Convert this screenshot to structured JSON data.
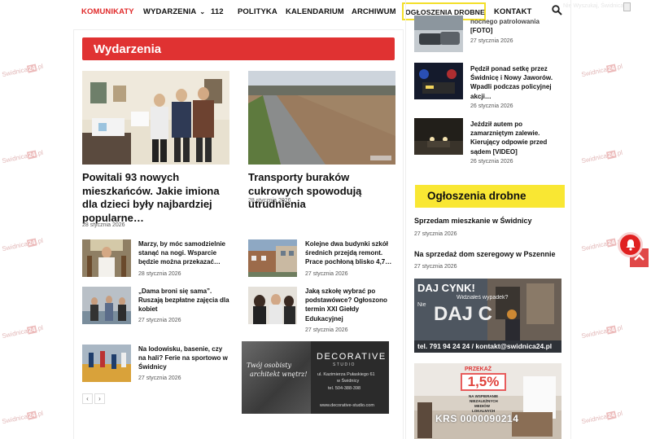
{
  "nav": {
    "items": [
      "KOMUNIKATY",
      "WYDARZENIA",
      "112",
      "POLITYKA",
      "KALENDARIUM",
      "ARCHIWUM",
      "OGŁOSZENIA DROBNE",
      "KONTAKT"
    ],
    "active": "KOMUNIKATY",
    "highlighted": "OGŁOSZENIA DROBNE",
    "ghost_text": "Nie Wyszukaj, Świdnica",
    "icons": [
      "chevron-down-icon",
      "search-icon"
    ]
  },
  "watermark": {
    "prefix": "Swidnica",
    "suffix": "24",
    "tld": ".pl"
  },
  "section": {
    "title": "Wydarzenia"
  },
  "featured": [
    {
      "title": "Powitali 93 nowych mieszkańców. Jakie imiona dla dzieci były najbardziej popularne…",
      "date": "28 stycznia 2026"
    },
    {
      "title": "Transporty buraków cukrowych spowodują utrudnienia",
      "date": "28 stycznia 2026"
    }
  ],
  "small_left": [
    {
      "title": "Marzy, by móc samodzielnie stanąć na nogi. Wsparcie będzie można przekazać…",
      "date": "28 stycznia 2026"
    },
    {
      "title": "„Dama broni się sama”. Ruszają bezpłatne zajęcia dla kobiet",
      "date": "27 stycznia 2026"
    },
    {
      "title": "Na lodowisku, basenie, czy na hali? Ferie na sportowo w Świdnicy",
      "date": "27 stycznia 2026"
    }
  ],
  "small_right": [
    {
      "title": "Kolejne dwa budynki szkół średnich przejdą remont. Prace pochłoną blisko 4,7…",
      "date": "27 stycznia 2026"
    },
    {
      "title": "Jaką szkołę wybrać po podstawówce? Ogłoszono termin XXI Giełdy Edukacyjnej",
      "date": "27 stycznia 2026"
    }
  ],
  "pager": {
    "prev": "‹",
    "next": "›"
  },
  "ad_decorative": {
    "script_line1": "Twój osobisty",
    "script_line2": "architekt wnętrz!",
    "brand": "DECORATIVE",
    "brand_sub": "STUDIO",
    "address1": "ul. Kazimierza Pułaskiego 61",
    "address2": "w Świdnicy",
    "phone": "tel. 504-388-398",
    "website": "www.decorative-studio.com"
  },
  "sidebar_news": [
    {
      "title_line1": "nocnego patrolowania",
      "title_line2": "[FOTO]",
      "date": "27 stycznia 2026"
    },
    {
      "title": "Pędził ponad setkę przez Świdnicę i Nowy Jaworów. Wpadli podczas policyjnej akcji…",
      "date": "26 stycznia 2026"
    },
    {
      "title": "Jeździł autem po zamarzniętym zalewie. Kierujący odpowie przed sądem [VIDEO]",
      "date": "26 stycznia 2026"
    }
  ],
  "ogloszenia": {
    "header": "Ogłoszenia drobne",
    "items": [
      {
        "title": "Sprzedam mieszkanie w Świdnicy",
        "date": "27 stycznia 2026"
      },
      {
        "title": "Na sprzedaż dom szeregowy w Pszennie",
        "date": "27 stycznia 2026"
      }
    ]
  },
  "ad_cynk": {
    "headline": "DAJ CYNK!",
    "question1": "Widziałeś wypadek?",
    "question2": "Nie",
    "big_text": "DAJ C",
    "contact": "tel. 791 94 24 24 / kontakt@swidnica24.pl"
  },
  "ad_krs": {
    "label": "PRZEKAŻ",
    "percent": "1,5%",
    "sub1": "NA WSPIERANIE",
    "sub2": "NIEZALEŻNYCH",
    "sub3": "MEDIÓW",
    "sub4": "LOKALNYCH",
    "krs": "KRS 0000090214"
  },
  "colors": {
    "accent_red": "#e03232",
    "highlight_yellow": "#f9e733",
    "nav_active": "#e02a2a"
  }
}
